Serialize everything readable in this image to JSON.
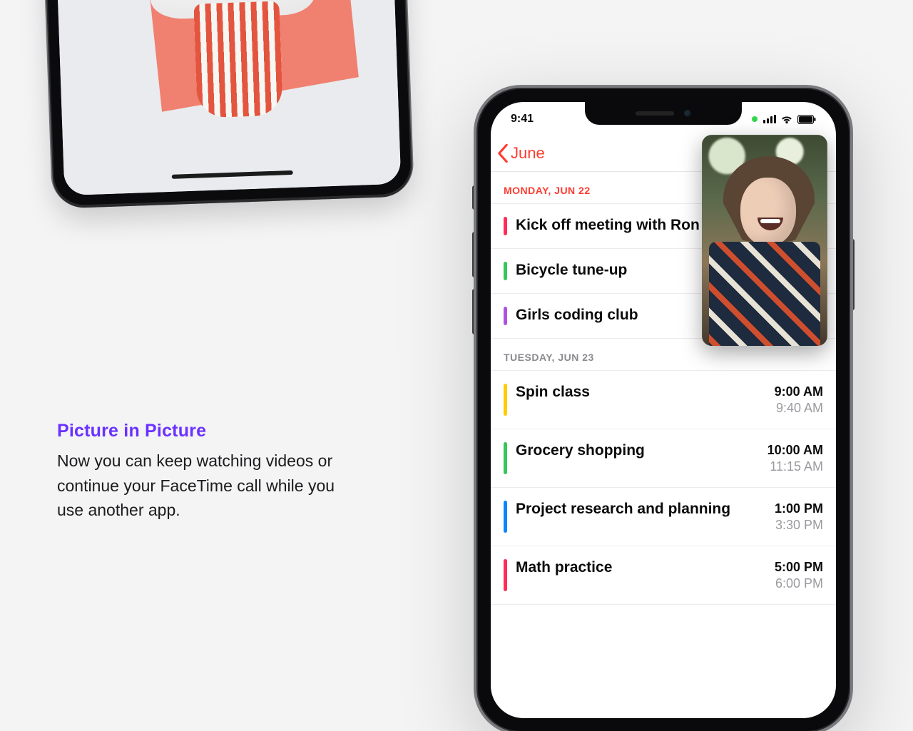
{
  "text": {
    "heading": "Picture in Picture",
    "body": "Now you can keep watching videos or continue your FaceTime call while you use another app."
  },
  "phone": {
    "status_time": "9:41",
    "back_label": "June",
    "days": [
      {
        "header": "MONDAY, JUN 22",
        "today": true,
        "events": [
          {
            "title": "Kick off meeting with Ron",
            "color": "#ff2d55",
            "start": "",
            "end": ""
          },
          {
            "title": "Bicycle tune-up",
            "color": "#34c759",
            "start": "",
            "end": ""
          },
          {
            "title": "Girls coding club",
            "color": "#af52de",
            "start": "",
            "end": ""
          }
        ]
      },
      {
        "header": "TUESDAY, JUN 23",
        "today": false,
        "events": [
          {
            "title": "Spin class",
            "color": "#ffcc00",
            "start": "9:00 AM",
            "end": "9:40 AM"
          },
          {
            "title": "Grocery shopping",
            "color": "#34c759",
            "start": "10:00 AM",
            "end": "11:15 AM"
          },
          {
            "title": "Project research and planning",
            "color": "#0a84ff",
            "start": "1:00 PM",
            "end": "3:30 PM"
          },
          {
            "title": "Math practice",
            "color": "#ff2d55",
            "start": "5:00 PM",
            "end": "6:00 PM"
          }
        ]
      }
    ]
  }
}
